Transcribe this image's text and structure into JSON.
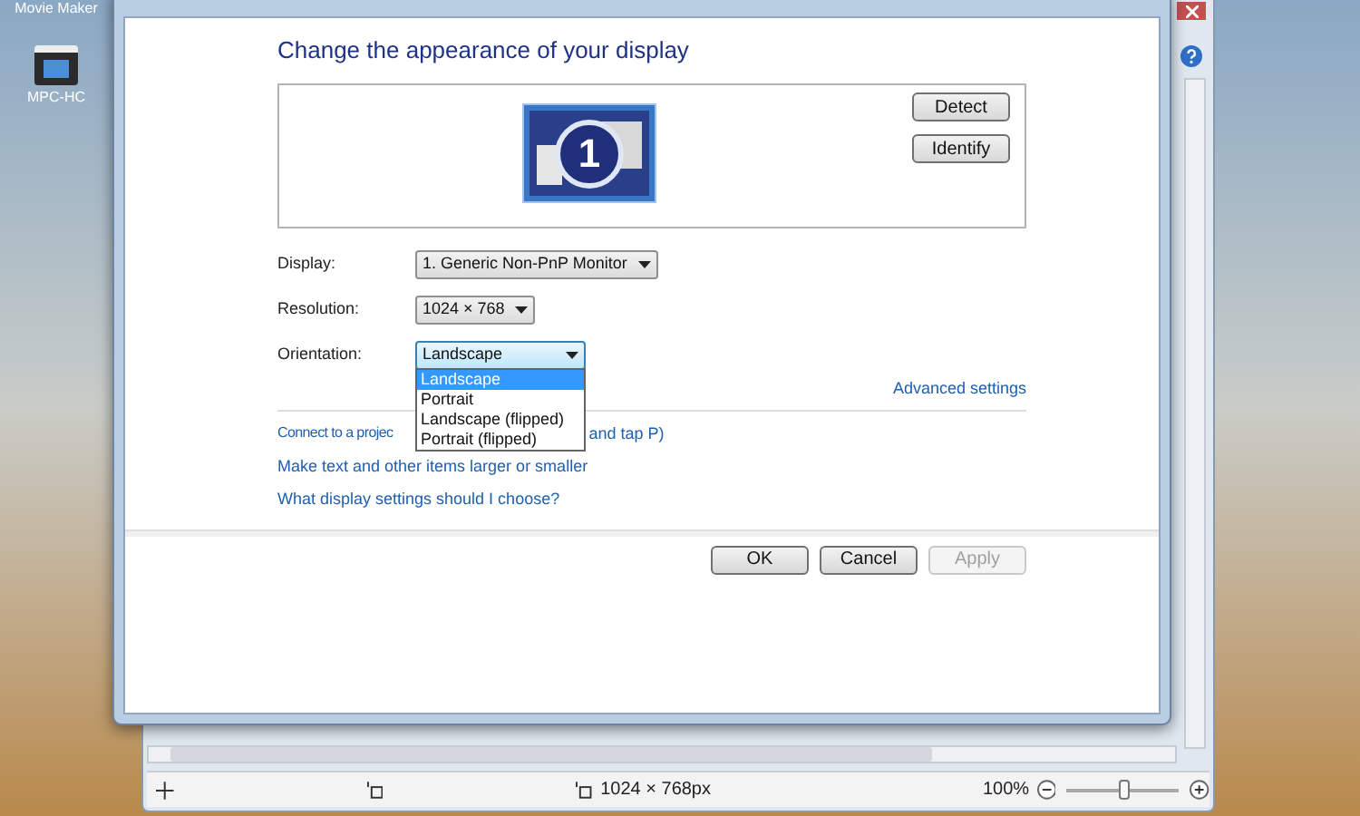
{
  "desktop": {
    "icons": [
      {
        "label": "Movie Maker"
      },
      {
        "label": "MPC-HC"
      }
    ]
  },
  "dialog": {
    "heading": "Change the appearance of your display",
    "monitor": {
      "number": "1",
      "selected": true
    },
    "preview_buttons": [
      "Detect",
      "Identify"
    ],
    "settings": [
      {
        "label": "Display:",
        "value": "1. Generic Non-PnP Monitor",
        "expanded": false
      },
      {
        "label": "Resolution:",
        "value": "1024 × 768",
        "expanded": false
      },
      {
        "label": "Orientation:",
        "value": "Landscape",
        "expanded": true
      }
    ],
    "orientation_options": [
      {
        "label": "Landscape",
        "selected": true
      },
      {
        "label": "Portrait",
        "selected": false
      },
      {
        "label": "Landscape (flipped)",
        "selected": false
      },
      {
        "label": "Portrait (flipped)",
        "selected": false
      }
    ],
    "advanced_link": "Advanced settings",
    "projector_link": {
      "before": "Connect to a projec",
      "after": "and tap P)"
    },
    "links": [
      "Make text and other items larger or smaller",
      "What display settings should I choose?"
    ],
    "buttons": [
      {
        "label": "OK",
        "disabled": false
      },
      {
        "label": "Cancel",
        "disabled": false
      },
      {
        "label": "Apply",
        "disabled": true
      }
    ]
  },
  "viewer": {
    "dimensions": "1024 × 768px",
    "zoom": "100%",
    "zoom_slider": {
      "level": 0.5
    }
  }
}
